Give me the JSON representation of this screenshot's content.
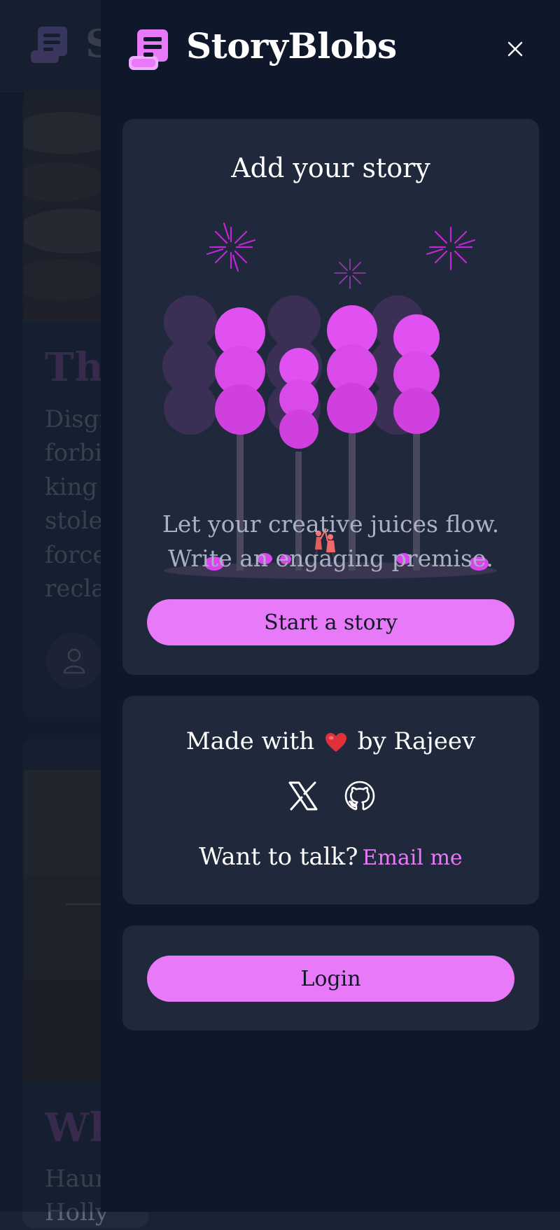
{
  "app": {
    "name": "StoryBlobs"
  },
  "background": {
    "brand_partial": "S",
    "card1": {
      "title_partial": "The",
      "lines": [
        "Disgr",
        "forbi",
        "king",
        "stole",
        "force",
        "recla"
      ]
    },
    "card2": {
      "title_partial": "Wh",
      "lines": [
        "Haun",
        "Holly"
      ]
    }
  },
  "drawer": {
    "title": "StoryBlobs",
    "close_icon": "close-icon",
    "add_story": {
      "heading": "Add your story",
      "tagline_line1": "Let your creative juices flow.",
      "tagline_line2": "Write an engaging premise.",
      "button": "Start a story"
    },
    "credits": {
      "made_with": "Made with",
      "by": "by Rajeev",
      "socials": [
        "x-icon",
        "github-icon"
      ],
      "talk": "Want to talk?",
      "email_link": "Email me"
    },
    "login": {
      "button": "Login"
    }
  },
  "colors": {
    "accent": "#e879f9",
    "drawer_bg": "#0f172a",
    "panel_bg": "#1f293b"
  }
}
